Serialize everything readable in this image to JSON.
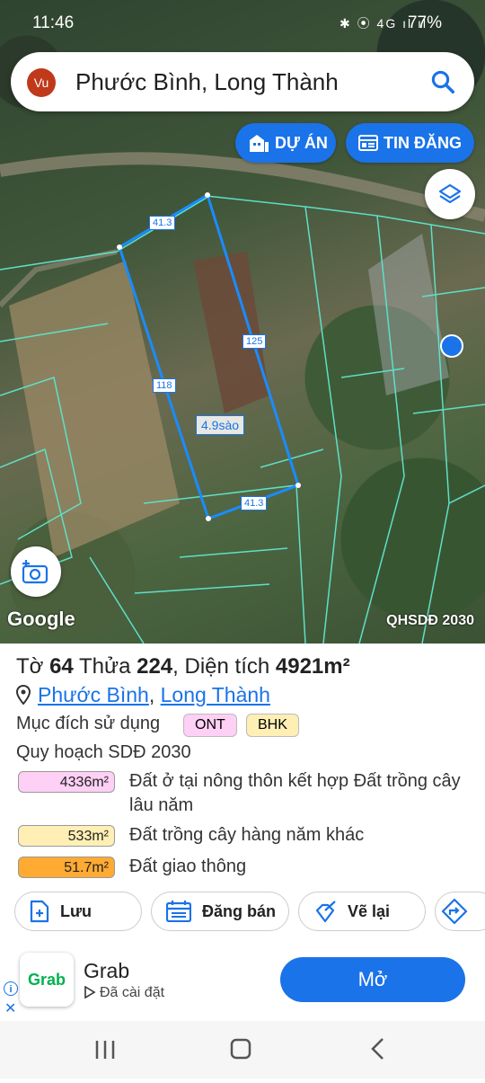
{
  "status": {
    "time": "11:46",
    "battery": "77%",
    "icons": "✱ ⦿ 4G ıl ıl"
  },
  "search": {
    "avatar": "Vu",
    "query": "Phước Bình, Long Thành"
  },
  "map_buttons": {
    "du_an": "DỰ ÁN",
    "tin_dang": "TIN ĐĂNG"
  },
  "map": {
    "google": "Google",
    "overlay": "QHSDĐ 2030",
    "edge_labels": [
      "41.3",
      "125",
      "118",
      "41.3"
    ],
    "area_label": "4.9sào"
  },
  "parcel": {
    "to_label": "Tờ",
    "to": "64",
    "thua_label": "Thửa",
    "thua": "224",
    "dt_label": "Diện tích",
    "dt": "4921m²",
    "ward": "Phước Bình",
    "district": "Long Thành",
    "purpose_label": "Mục đích sử dụng",
    "tags": [
      "ONT",
      "BHK"
    ],
    "plan_label": "Quy hoạch SDĐ 2030",
    "land_uses": [
      {
        "area": "4336m²",
        "desc": "Đất ở tại nông thôn kết hợp Đất trồng cây lâu năm",
        "color": "#ffd0f5"
      },
      {
        "area": "533m²",
        "desc": "Đất trồng cây hàng năm khác",
        "color": "#ffefb5"
      },
      {
        "area": "51.7m²",
        "desc": "Đất giao thông",
        "color": "#ffaa33"
      }
    ]
  },
  "actions": {
    "save": "Lưu",
    "post": "Đăng bán",
    "redraw": "Vẽ lại"
  },
  "ad": {
    "logo": "Grab",
    "name": "Grab",
    "sub": "Đã cài đặt",
    "button": "Mở"
  }
}
